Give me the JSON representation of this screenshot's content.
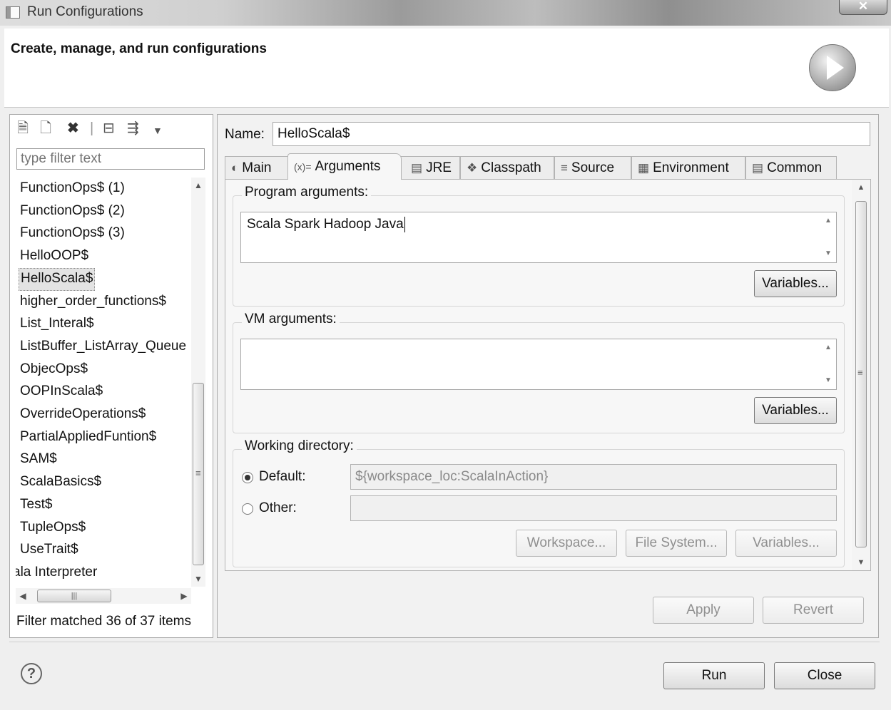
{
  "window": {
    "title": "Run Configurations",
    "close_glyph": "✕"
  },
  "header": {
    "title": "Create, manage, and run configurations",
    "logo_icon": "run-play-icon"
  },
  "left": {
    "toolbar_icons": [
      "new-config-icon",
      "duplicate-icon",
      "delete-icon",
      "collapse-all-icon",
      "filter-icon",
      "dropdown-arrow-icon"
    ],
    "filter_placeholder": "type filter text",
    "items": [
      "FunctionOps$ (1)",
      "FunctionOps$ (2)",
      "FunctionOps$ (3)",
      "HelloOOP$",
      "HelloScala$",
      "higher_order_functions$",
      "List_Interal$",
      "ListBuffer_ListArray_Queue",
      "ObjecOps$",
      "OOPInScala$",
      "OverrideOperations$",
      "PartialAppliedFuntion$",
      "SAM$",
      "ScalaBasics$",
      "Test$",
      "TupleOps$",
      "UseTrait$",
      "ala Interpreter"
    ],
    "selected_index": 4,
    "status": "Filter matched 36 of 37 items"
  },
  "right": {
    "name_label": "Name:",
    "name_value": "HelloScala$",
    "tabs": [
      {
        "label": "Main",
        "icon": "main-tab-icon"
      },
      {
        "label": "Arguments",
        "icon": "arguments-tab-icon",
        "icon_glyph": "(x)="
      },
      {
        "label": "JRE",
        "icon": "jre-tab-icon"
      },
      {
        "label": "Classpath",
        "icon": "classpath-tab-icon"
      },
      {
        "label": "Source",
        "icon": "source-tab-icon"
      },
      {
        "label": "Environment",
        "icon": "environment-tab-icon"
      },
      {
        "label": "Common",
        "icon": "common-tab-icon"
      }
    ],
    "active_tab": "Arguments",
    "program_args": {
      "label": "Program arguments:",
      "value": "Scala Spark  Hadoop Java",
      "variables_btn": "Variables..."
    },
    "vm_args": {
      "label": "VM arguments:",
      "value": "",
      "variables_btn": "Variables..."
    },
    "working_dir": {
      "label": "Working directory:",
      "default_label": "Default:",
      "default_value": "${workspace_loc:ScalaInAction}",
      "other_label": "Other:",
      "other_value": "",
      "selected": "Default",
      "workspace_btn": "Workspace...",
      "filesystem_btn": "File System...",
      "variables_btn": "Variables..."
    },
    "apply_btn": "Apply",
    "revert_btn": "Revert"
  },
  "footer": {
    "run_btn": "Run",
    "close_btn": "Close",
    "help_glyph": "?"
  }
}
